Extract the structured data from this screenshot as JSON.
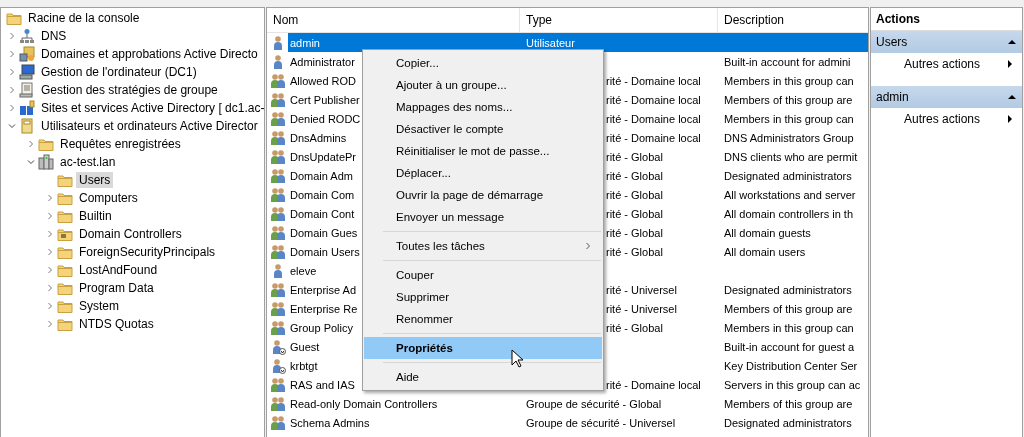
{
  "tree": {
    "label": "Racine de la console",
    "kind": "folder",
    "selected": false,
    "children": [
      {
        "label": "DNS",
        "kind": "dns",
        "expanded": false,
        "selected": false
      },
      {
        "label": "Domaines et approbations Active Directo",
        "kind": "domains",
        "expanded": false,
        "selected": false
      },
      {
        "label": "Gestion de l'ordinateur (DC1)",
        "kind": "computer",
        "expanded": false,
        "selected": false
      },
      {
        "label": "Gestion des stratégies de groupe",
        "kind": "policy",
        "expanded": false,
        "selected": false
      },
      {
        "label": "Sites et services Active Directory [ dc1.ac-",
        "kind": "sites",
        "expanded": false,
        "selected": false
      },
      {
        "label": "Utilisateurs et ordinateurs Active Director",
        "kind": "book",
        "expanded": true,
        "selected": false,
        "children": [
          {
            "label": "Requêtes enregistrées",
            "kind": "folder",
            "expanded": false,
            "selected": false
          },
          {
            "label": "ac-test.lan",
            "kind": "domain",
            "expanded": true,
            "selected": false,
            "children": [
              {
                "label": "Users",
                "kind": "folder",
                "selected": true
              },
              {
                "label": "Computers",
                "kind": "folder",
                "expanded": false,
                "selected": false
              },
              {
                "label": "Builtin",
                "kind": "folder",
                "expanded": false,
                "selected": false
              },
              {
                "label": "Domain Controllers",
                "kind": "ou",
                "expanded": false,
                "selected": false
              },
              {
                "label": "ForeignSecurityPrincipals",
                "kind": "folder",
                "expanded": false,
                "selected": false
              },
              {
                "label": "LostAndFound",
                "kind": "folder",
                "expanded": false,
                "selected": false
              },
              {
                "label": "Program Data",
                "kind": "folder",
                "expanded": false,
                "selected": false
              },
              {
                "label": "System",
                "kind": "folder",
                "expanded": false,
                "selected": false
              },
              {
                "label": "NTDS Quotas",
                "kind": "folder",
                "expanded": false,
                "selected": false
              }
            ]
          }
        ]
      }
    ]
  },
  "list": {
    "columns": [
      "Nom",
      "Type",
      "Description"
    ],
    "rows": [
      {
        "kind": "user",
        "name": "admin",
        "type": "Utilisateur",
        "selected": true
      },
      {
        "kind": "user",
        "name": "Administrator",
        "description": "Built-in account for admini",
        "selected": false
      },
      {
        "kind": "group",
        "name": "Allowed ROD",
        "type": "rité - Domaine local",
        "description": "Members in this group can",
        "selected": false
      },
      {
        "kind": "group",
        "name": "Cert Publisher",
        "type": "rité - Domaine local",
        "description": "Members of this group are",
        "selected": false
      },
      {
        "kind": "group",
        "name": "Denied RODC",
        "type": "rité - Domaine local",
        "description": "Members in this group can",
        "selected": false
      },
      {
        "kind": "group",
        "name": "DnsAdmins",
        "type": "rité - Domaine local",
        "description": "DNS Administrators Group",
        "selected": false
      },
      {
        "kind": "group",
        "name": "DnsUpdatePr",
        "type": "rité - Global",
        "description": "DNS clients who are permit",
        "selected": false
      },
      {
        "kind": "group",
        "name": "Domain Adm",
        "type": "rité - Global",
        "description": "Designated administrators",
        "selected": false
      },
      {
        "kind": "group",
        "name": "Domain Com",
        "type": "rité - Global",
        "description": "All workstations and server",
        "selected": false
      },
      {
        "kind": "group",
        "name": "Domain Cont",
        "type": "rité - Global",
        "description": "All domain controllers in th",
        "selected": false
      },
      {
        "kind": "group",
        "name": "Domain Gues",
        "type": "rité - Global",
        "description": "All domain guests",
        "selected": false
      },
      {
        "kind": "group",
        "name": "Domain Users",
        "type": "rité - Global",
        "description": "All domain users",
        "selected": false
      },
      {
        "kind": "user",
        "name": "eleve",
        "selected": false
      },
      {
        "kind": "group",
        "name": "Enterprise Ad",
        "type": "rité - Universel",
        "description": "Designated administrators",
        "selected": false
      },
      {
        "kind": "group",
        "name": "Enterprise Re",
        "type": "rité - Universel",
        "description": "Members of this group are",
        "selected": false
      },
      {
        "kind": "group",
        "name": "Group Policy",
        "type": "rité - Global",
        "description": "Members in this group can",
        "selected": false
      },
      {
        "kind": "user-disabled",
        "name": "Guest",
        "description": "Built-in account for guest a",
        "selected": false
      },
      {
        "kind": "user-disabled",
        "name": "krbtgt",
        "description": "Key Distribution Center Ser",
        "selected": false
      },
      {
        "kind": "group",
        "name": "RAS and IAS",
        "type": "rité - Domaine local",
        "description": "Servers in this group can ac",
        "selected": false
      },
      {
        "kind": "group",
        "name": "Read-only Domain Controllers",
        "type": "Groupe de sécurité - Global",
        "description": "Members of this group are",
        "selected": false
      },
      {
        "kind": "group",
        "name": "Schema Admins",
        "type": "Groupe de sécurité - Universel",
        "description": "Designated administrators",
        "selected": false
      }
    ]
  },
  "context_menu": [
    {
      "kind": "item",
      "label": "Copier...",
      "selected": false,
      "default": false
    },
    {
      "kind": "item",
      "label": "Ajouter à un groupe...",
      "selected": false,
      "default": false
    },
    {
      "kind": "item",
      "label": "Mappages des noms...",
      "selected": false,
      "default": false
    },
    {
      "kind": "item",
      "label": "Désactiver le compte",
      "selected": false,
      "default": false
    },
    {
      "kind": "item",
      "label": "Réinitialiser le mot de passe...",
      "selected": false,
      "default": false
    },
    {
      "kind": "item",
      "label": "Déplacer...",
      "selected": false,
      "default": false
    },
    {
      "kind": "item",
      "label": "Ouvrir la page de démarrage",
      "selected": false,
      "default": false
    },
    {
      "kind": "item",
      "label": "Envoyer un message",
      "selected": false,
      "default": false
    },
    {
      "kind": "separator"
    },
    {
      "kind": "submenu",
      "label": "Toutes les tâches",
      "selected": false,
      "default": false
    },
    {
      "kind": "separator"
    },
    {
      "kind": "item",
      "label": "Couper",
      "selected": false,
      "default": false
    },
    {
      "kind": "item",
      "label": "Supprimer",
      "selected": false,
      "default": false
    },
    {
      "kind": "item",
      "label": "Renommer",
      "selected": false,
      "default": false
    },
    {
      "kind": "separator"
    },
    {
      "kind": "item",
      "label": "Propriétés",
      "selected": true,
      "default": true
    },
    {
      "kind": "separator"
    },
    {
      "kind": "item",
      "label": "Aide",
      "selected": false,
      "default": false
    }
  ],
  "actions": {
    "title": "Actions",
    "sections": [
      {
        "header": "Users",
        "items": [
          "Autres actions"
        ]
      },
      {
        "header": "admin",
        "items": [
          "Autres actions"
        ]
      }
    ]
  }
}
